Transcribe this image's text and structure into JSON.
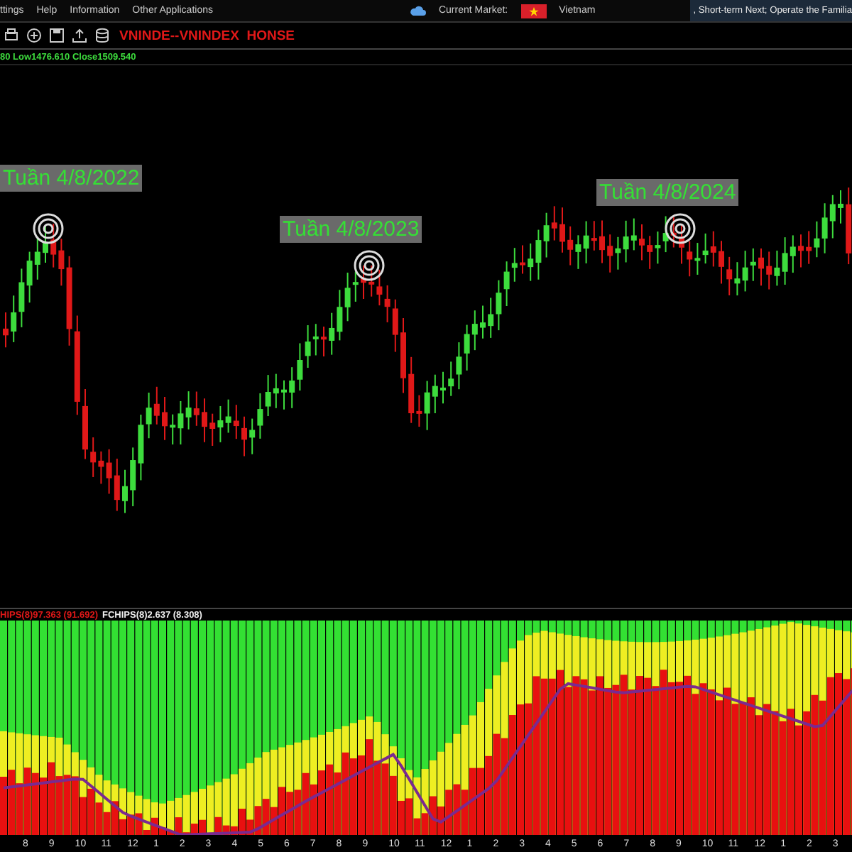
{
  "menu": [
    "ttings",
    "Help",
    "Information",
    "Other Applications"
  ],
  "market": {
    "label": "Current Market:",
    "value": "Vietnam"
  },
  "ticker": ", Short-term Next; Operate the Familia",
  "symbol": "VNINDE--VNINDEX  HONSE",
  "price_info": "80 Low1476.610 Close1509.540",
  "annotations": [
    {
      "label": "Tuần 4/8/2022"
    },
    {
      "label": "Tuần 4/8/2023"
    },
    {
      "label": "Tuần 4/8/2024"
    }
  ],
  "indicator": {
    "primary": "HIPS(8)97.363 (91.692)",
    "secondary": "FCHIPS(8)2.637 (8.308)"
  },
  "x_axis_labels": [
    "8",
    "9",
    "10",
    "11",
    "12",
    "1",
    "2",
    "3",
    "4",
    "5",
    "6",
    "7",
    "8",
    "9",
    "10",
    "11",
    "12",
    "1",
    "2",
    "3",
    "4",
    "5",
    "6",
    "7",
    "8",
    "9",
    "10",
    "11",
    "12",
    "1",
    "2",
    "3"
  ]
}
